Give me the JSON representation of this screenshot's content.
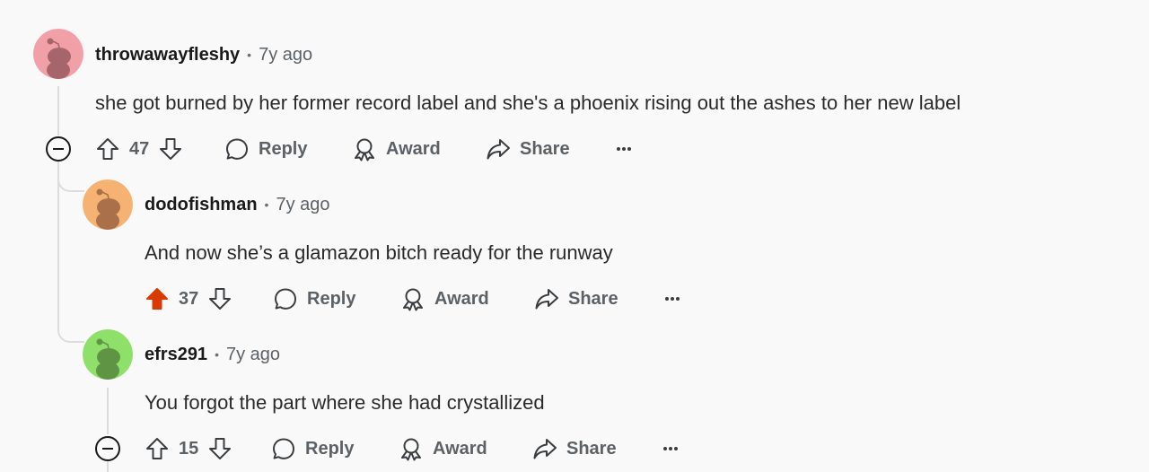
{
  "comments": [
    {
      "username": "throwawayfleshy",
      "separator": "•",
      "time": "7y ago",
      "body": "she got burned by her former record label and she's a phoenix rising out the ashes to her new label",
      "score": "47",
      "upvoted": false,
      "avatar_color": "#f2a0a7"
    },
    {
      "username": "dodofishman",
      "separator": "•",
      "time": "7y ago",
      "body": "And now she’s a glamazon bitch ready for the runway",
      "score": "37",
      "upvoted": true,
      "avatar_color": "#f5b272"
    },
    {
      "username": "efrs291",
      "separator": "•",
      "time": "7y ago",
      "body": "You forgot the part where she had crystallized",
      "score": "15",
      "upvoted": false,
      "avatar_color": "#8fe06a"
    }
  ],
  "actions": {
    "reply_label": "Reply",
    "award_label": "Award",
    "share_label": "Share"
  },
  "colors": {
    "upvote_active": "#d93a00",
    "muted_text": "#5c6166"
  }
}
